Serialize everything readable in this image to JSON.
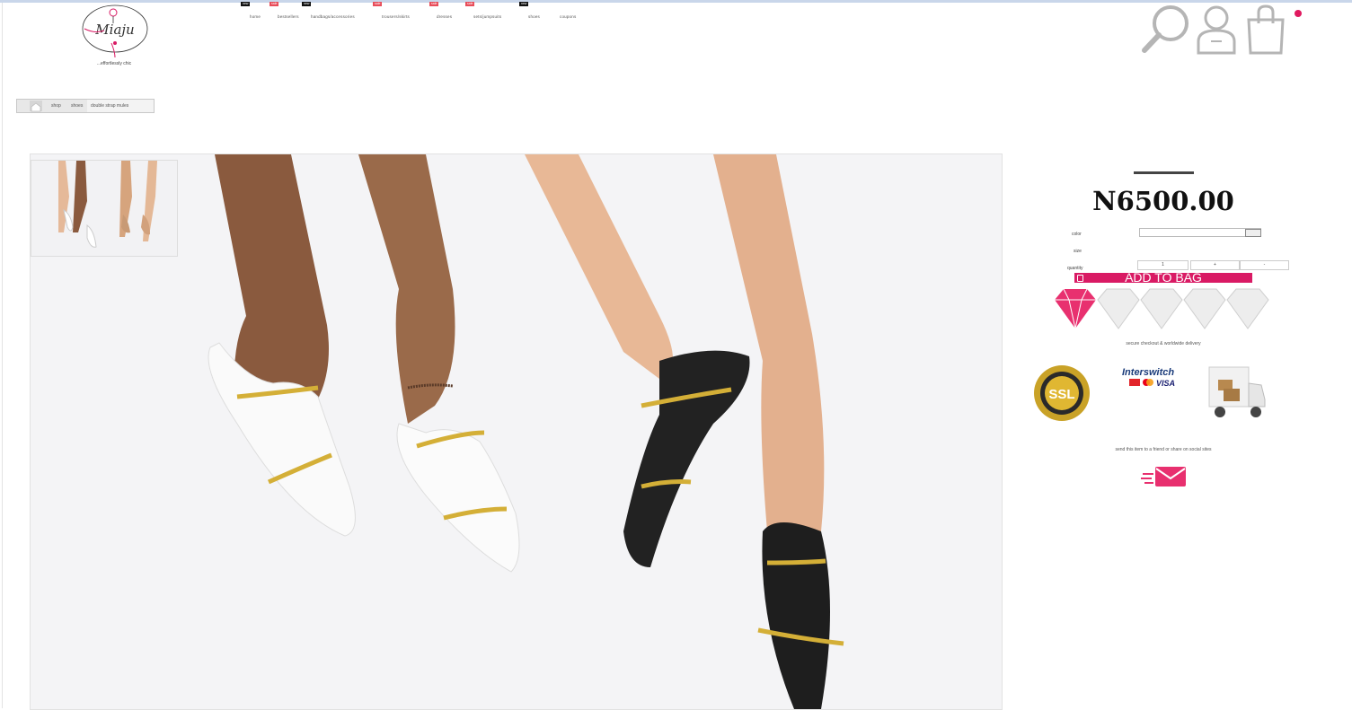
{
  "brand": {
    "logo_text": "Miaju",
    "tagline": "...effortlessly chic"
  },
  "nav": {
    "items": [
      {
        "label": "home",
        "badge": "new",
        "badge_type": "new"
      },
      {
        "label": "bestsellers",
        "badge": "sale",
        "badge_type": "sale"
      },
      {
        "label": "handbags/accessories",
        "badge": "new",
        "badge_type": "new"
      },
      {
        "label": "trousers/skirts",
        "badge": "sale",
        "badge_type": "sale"
      },
      {
        "label": "dresses",
        "badge": "sale",
        "badge_type": "sale"
      },
      {
        "label": "sets/jumpsuits",
        "badge": "sale",
        "badge_type": "sale"
      },
      {
        "label": "shoes",
        "badge": "new",
        "badge_type": "new"
      },
      {
        "label": "coupons",
        "badge": "",
        "badge_type": ""
      }
    ]
  },
  "header_icons": {
    "search": "search-icon",
    "account": "user-icon",
    "cart": "shopping-bag-icon"
  },
  "breadcrumb": {
    "home": "home-icon",
    "items": [
      "shop",
      "shoes",
      "double strap mules"
    ]
  },
  "product": {
    "price": "N6500.00",
    "options": {
      "color_label": "color",
      "size_label": "size",
      "quantity_label": "quantity"
    },
    "quantity": {
      "value": "1",
      "minus": "-",
      "plus": "+"
    },
    "add_to_bag": "ADD TO BAG",
    "rating": {
      "filled": 1,
      "total": 5
    },
    "delivery_note": "secure checkout & worldwide delivery",
    "share_note": "send this item to a friend or share on social sites",
    "trust_badges": [
      "SSL",
      "Interswitch",
      "VISA"
    ]
  },
  "colors": {
    "accent": "#d91a64",
    "diamond_filled": "#e8306f",
    "diamond_empty": "#d9d9d9"
  }
}
